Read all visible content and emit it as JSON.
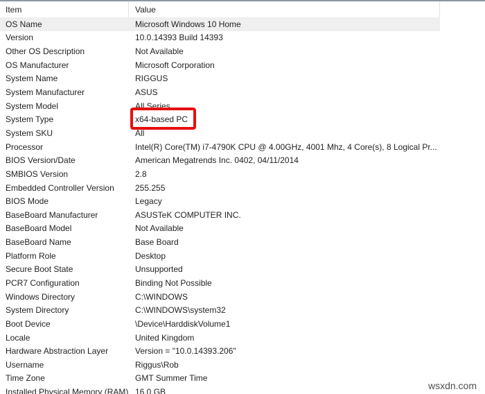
{
  "watermark": "wsxdn.com",
  "colors": {
    "top_border": "#8b97a0",
    "row_highlight": "#efefef",
    "header_divider": "#e2e2e2",
    "text": "#1f1f1f",
    "accent_red": "#e60f0f",
    "watermark": "#4d4d4d"
  },
  "table": {
    "columns": [
      "Item",
      "Value"
    ],
    "rows": [
      {
        "item": "OS Name",
        "value": "Microsoft Windows 10 Home",
        "highlighted": true
      },
      {
        "item": "Version",
        "value": "10.0.14393 Build 14393"
      },
      {
        "item": "Other OS Description",
        "value": "Not Available"
      },
      {
        "item": "OS Manufacturer",
        "value": "Microsoft Corporation"
      },
      {
        "item": "System Name",
        "value": "RIGGUS"
      },
      {
        "item": "System Manufacturer",
        "value": "ASUS"
      },
      {
        "item": "System Model",
        "value": "All Series"
      },
      {
        "item": "System Type",
        "value": "x64-based PC",
        "red_box": true
      },
      {
        "item": "System SKU",
        "value": "All"
      },
      {
        "item": "Processor",
        "value": "Intel(R) Core(TM) i7-4790K CPU @ 4.00GHz, 4001 Mhz, 4 Core(s), 8 Logical Pr..."
      },
      {
        "item": "BIOS Version/Date",
        "value": "American Megatrends Inc. 0402, 04/11/2014"
      },
      {
        "item": "SMBIOS Version",
        "value": "2.8"
      },
      {
        "item": "Embedded Controller Version",
        "value": "255.255"
      },
      {
        "item": "BIOS Mode",
        "value": "Legacy"
      },
      {
        "item": "BaseBoard Manufacturer",
        "value": "ASUSTeK COMPUTER INC."
      },
      {
        "item": "BaseBoard Model",
        "value": "Not Available"
      },
      {
        "item": "BaseBoard Name",
        "value": "Base Board"
      },
      {
        "item": "Platform Role",
        "value": "Desktop"
      },
      {
        "item": "Secure Boot State",
        "value": "Unsupported"
      },
      {
        "item": "PCR7 Configuration",
        "value": "Binding Not Possible"
      },
      {
        "item": "Windows Directory",
        "value": "C:\\WINDOWS"
      },
      {
        "item": "System Directory",
        "value": "C:\\WINDOWS\\system32"
      },
      {
        "item": "Boot Device",
        "value": "\\Device\\HarddiskVolume1"
      },
      {
        "item": "Locale",
        "value": "United Kingdom"
      },
      {
        "item": "Hardware Abstraction Layer",
        "value": "Version = \"10.0.14393.206\""
      },
      {
        "item": "Username",
        "value": "Riggus\\Rob"
      },
      {
        "item": "Time Zone",
        "value": "GMT Summer Time"
      },
      {
        "item": "Installed Physical Memory (RAM)",
        "value": "16.0 GB"
      }
    ]
  }
}
